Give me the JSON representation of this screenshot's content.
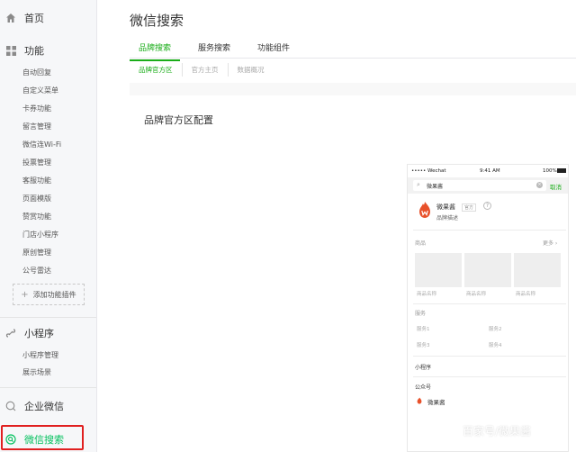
{
  "sidebar": {
    "home": "首页",
    "functions": {
      "label": "功能",
      "items": [
        "自动回复",
        "自定义菜单",
        "卡券功能",
        "留言管理",
        "微信连Wi-Fi",
        "投票管理",
        "客服功能",
        "页面模版",
        "赞赏功能",
        "门店小程序",
        "原创管理",
        "公号雷达"
      ],
      "add_label": "添加功能插件"
    },
    "miniprogram": {
      "label": "小程序",
      "items": [
        "小程序管理",
        "展示场景"
      ]
    },
    "work_wechat": "企业微信",
    "wechat_search": "微信搜索"
  },
  "main": {
    "title": "微信搜索",
    "tabs": [
      "品牌搜索",
      "服务搜索",
      "功能组件"
    ],
    "subtabs": [
      "品牌官方区",
      "官方主页",
      "数据概况"
    ],
    "section_title": "品牌官方区配置"
  },
  "phone": {
    "carrier": "••••• Wechat",
    "time": "9:41 AM",
    "battery": "100%",
    "query": "微果酱",
    "cancel": "取消",
    "brand_name": "微果酱",
    "brand_tag": "官方",
    "brand_desc": "品牌描述",
    "products_label": "商品",
    "more": "更多",
    "product_captions": [
      "商品名称",
      "商品名称",
      "商品名称"
    ],
    "services_label": "服务",
    "services": [
      "服务1",
      "服务2",
      "服务3",
      "服务4"
    ],
    "miniprogram_label": "小程序",
    "account_label": "公众号",
    "account_name": "微果酱"
  },
  "watermark": "百家号/微果酱",
  "colors": {
    "accent": "#1aad19",
    "highlight": "#e02020",
    "brand": "#e8512a"
  }
}
